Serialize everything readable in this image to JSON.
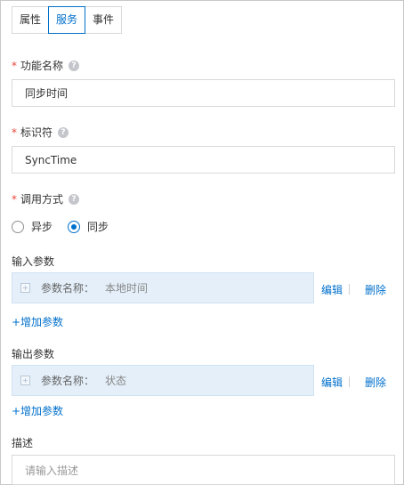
{
  "tabs": [
    {
      "label": "属性",
      "active": false
    },
    {
      "label": "服务",
      "active": true
    },
    {
      "label": "事件",
      "active": false
    }
  ],
  "function_name": {
    "label": "功能名称",
    "required_mark": "*",
    "value": "同步时间"
  },
  "identifier": {
    "label": "标识符",
    "required_mark": "*",
    "value": "SyncTime"
  },
  "call_method": {
    "label": "调用方式",
    "required_mark": "*",
    "options": [
      {
        "label": "异步",
        "checked": false
      },
      {
        "label": "同步",
        "checked": true
      }
    ]
  },
  "input_params": {
    "label": "输入参数",
    "items": [
      {
        "name_label": "参数名称：",
        "name": "本地时间"
      }
    ],
    "edit_label": "编辑",
    "delete_label": "删除",
    "add_label": "+增加参数"
  },
  "output_params": {
    "label": "输出参数",
    "items": [
      {
        "name_label": "参数名称：",
        "name": "状态"
      }
    ],
    "edit_label": "编辑",
    "delete_label": "删除",
    "add_label": "+增加参数"
  },
  "description": {
    "label": "描述",
    "placeholder": "请输入描述"
  },
  "help_icon": "question-circle",
  "colors": {
    "accent": "#0070cc",
    "required": "#e84738",
    "param_bg": "#e4eff9"
  }
}
